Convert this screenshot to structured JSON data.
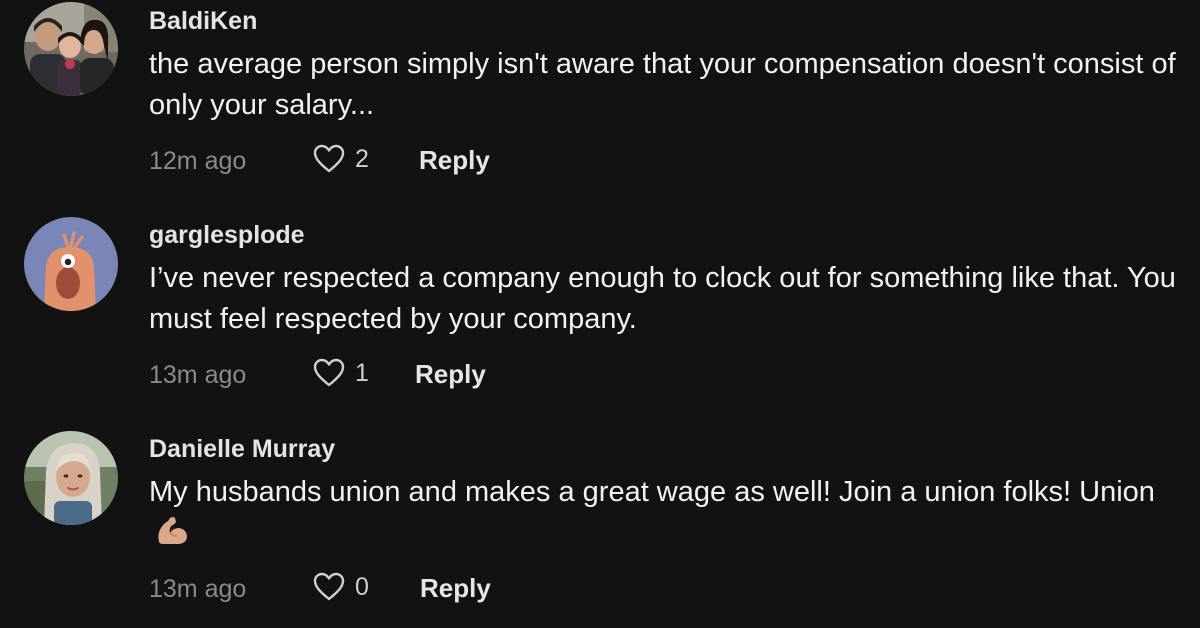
{
  "comments": [
    {
      "username": "BaldiKen",
      "text": "the average person simply isn't aware that your compensation doesn't consist of only your salary...",
      "time": "12m ago",
      "likes": "2",
      "reply_label": "Reply",
      "avatar_icon": "family-photo-avatar"
    },
    {
      "username": "garglesplode",
      "text": "I’ve never respected a company enough to clock out for something like that. You must feel respected by your company.",
      "time": "13m ago",
      "likes": "1",
      "reply_label": "Reply",
      "avatar_icon": "cartoon-creature-avatar"
    },
    {
      "username": "Danielle Murray",
      "text": "My husbands union and makes a great wage as well! Join a union folks! Union",
      "emoji": "flexed-biceps-icon",
      "time": "13m ago",
      "likes": "0",
      "reply_label": "Reply",
      "avatar_icon": "profile-photo-avatar"
    }
  ],
  "colors": {
    "background": "#121212",
    "username": "#e4e4e4",
    "text": "#f2f2f2",
    "meta": "#8a8a8a"
  }
}
